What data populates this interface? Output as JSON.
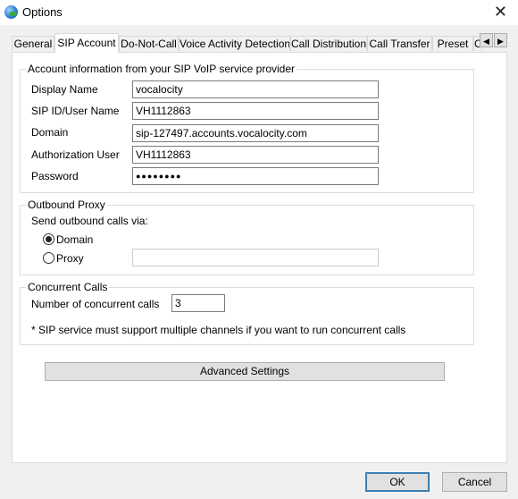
{
  "window": {
    "title": "Options",
    "close_glyph": "✕"
  },
  "tabs": [
    {
      "label": "General"
    },
    {
      "label": "SIP Account"
    },
    {
      "label": "Do-Not-Call"
    },
    {
      "label": "Voice Activity Detection"
    },
    {
      "label": "Call Distribution"
    },
    {
      "label": "Call Transfer"
    },
    {
      "label": "Preset"
    },
    {
      "label": "C"
    }
  ],
  "tab_scroll": {
    "left": "◀",
    "right": "▶"
  },
  "account": {
    "legend": "Account information from your SIP VoIP service provider",
    "display_name_label": "Display Name",
    "display_name_value": "vocalocity",
    "sip_id_label": "SIP ID/User Name",
    "sip_id_value": "VH1112863",
    "domain_label": "Domain",
    "domain_value": "sip-127497.accounts.vocalocity.com",
    "auth_user_label": "Authorization User",
    "auth_user_value": "VH1112863",
    "password_label": "Password",
    "password_value": "●●●●●●●●"
  },
  "outbound": {
    "legend": "Outbound Proxy",
    "send_via_label": "Send outbound calls via:",
    "domain_option": "Domain",
    "proxy_option": "Proxy",
    "selected": "Domain",
    "proxy_value": ""
  },
  "concurrent": {
    "legend": "Concurrent Calls",
    "number_label": "Number of concurrent calls",
    "number_value": "3",
    "note": "* SIP service must support multiple channels if you want to run concurrent calls"
  },
  "buttons": {
    "advanced": "Advanced Settings",
    "ok": "OK",
    "cancel": "Cancel"
  }
}
